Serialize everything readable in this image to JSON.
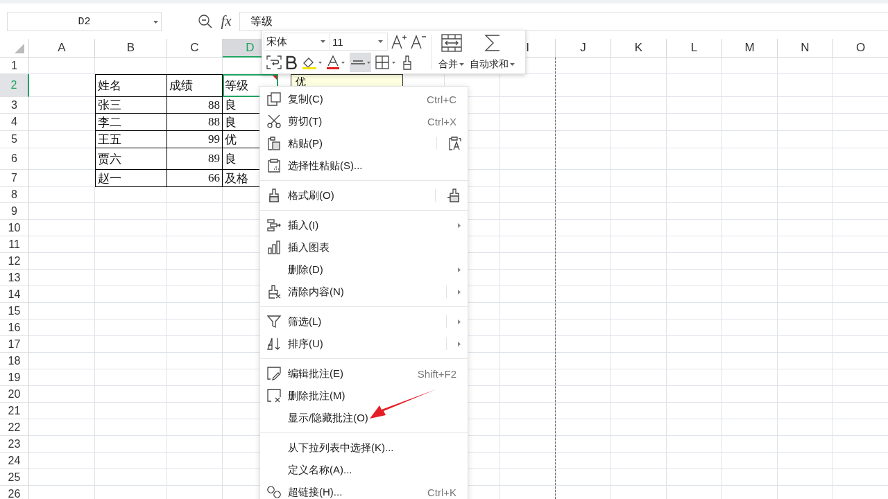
{
  "formula_bar": {
    "name_box": "D2",
    "function_label": "fx",
    "formula": "等级"
  },
  "sheet": {
    "columns": [
      {
        "label": "A",
        "selected": false
      },
      {
        "label": "B",
        "selected": false
      },
      {
        "label": "C",
        "selected": false
      },
      {
        "label": "D",
        "selected": true
      }
    ],
    "columns_after_toolbar": [
      {
        "label": "I",
        "selected": false
      },
      {
        "label": "J",
        "selected": false
      },
      {
        "label": "K",
        "selected": false
      },
      {
        "label": "L",
        "selected": false
      },
      {
        "label": "M",
        "selected": false
      },
      {
        "label": "N",
        "selected": false
      },
      {
        "label": "O",
        "selected": false
      }
    ],
    "rows": [
      {
        "label": "1",
        "selected": false
      },
      {
        "label": "2",
        "selected": true
      },
      {
        "label": "3",
        "selected": false
      },
      {
        "label": "4",
        "selected": false
      },
      {
        "label": "5",
        "selected": false
      },
      {
        "label": "6",
        "selected": false
      },
      {
        "label": "7",
        "selected": false
      },
      {
        "label": "8",
        "selected": false
      },
      {
        "label": "9",
        "selected": false
      },
      {
        "label": "10",
        "selected": false
      },
      {
        "label": "11",
        "selected": false
      },
      {
        "label": "12",
        "selected": false
      },
      {
        "label": "13",
        "selected": false
      },
      {
        "label": "14",
        "selected": false
      },
      {
        "label": "15",
        "selected": false
      },
      {
        "label": "16",
        "selected": false
      },
      {
        "label": "17",
        "selected": false
      },
      {
        "label": "18",
        "selected": false
      },
      {
        "label": "19",
        "selected": false
      },
      {
        "label": "20",
        "selected": false
      },
      {
        "label": "21",
        "selected": false
      },
      {
        "label": "22",
        "selected": false
      },
      {
        "label": "23",
        "selected": false
      },
      {
        "label": "24",
        "selected": false
      },
      {
        "label": "25",
        "selected": false
      },
      {
        "label": "26",
        "selected": false
      }
    ],
    "table": [
      [
        "姓名",
        "成绩",
        "等级"
      ],
      [
        "张三",
        "88",
        "良"
      ],
      [
        "李二",
        "88",
        "良"
      ],
      [
        "王五",
        "99",
        "优"
      ],
      [
        "贾六",
        "89",
        "良"
      ],
      [
        "赵一",
        "66",
        "及格"
      ]
    ],
    "comment": "优"
  },
  "mini_toolbar": {
    "font": "宋体",
    "size": "11",
    "alignment_active": true,
    "buttons": [
      "合并",
      "自动求和"
    ]
  },
  "context_menu": {
    "groups": [
      [
        {
          "label": "复制(C)",
          "shortcut": "Ctrl+C",
          "submenu": false
        },
        {
          "label": "剪切(T)",
          "shortcut": "Ctrl+X",
          "submenu": false
        },
        {
          "label": "粘贴(P)",
          "submenu": false
        },
        {
          "label": "选择性粘贴(S)...",
          "submenu": false
        }
      ],
      [
        {
          "label": "格式刷(O)",
          "submenu": false
        }
      ],
      [
        {
          "label": "插入(I)",
          "submenu": true
        },
        {
          "label": "插入图表",
          "submenu": false
        },
        {
          "label": "删除(D)",
          "submenu": true
        },
        {
          "label": "清除内容(N)",
          "submenu": true
        }
      ],
      [
        {
          "label": "筛选(L)",
          "submenu": true
        },
        {
          "label": "排序(U)",
          "submenu": true
        }
      ],
      [
        {
          "label": "编辑批注(E)",
          "shortcut": "Shift+F2",
          "submenu": false
        },
        {
          "label": "删除批注(M)",
          "submenu": false
        },
        {
          "label": "显示/隐藏批注(O)",
          "submenu": false
        }
      ],
      [
        {
          "label": "从下拉列表中选择(K)...",
          "submenu": false
        },
        {
          "label": "定义名称(A)...",
          "submenu": false
        },
        {
          "label": "超链接(H)...",
          "shortcut": "Ctrl+K",
          "submenu": false
        }
      ]
    ]
  }
}
